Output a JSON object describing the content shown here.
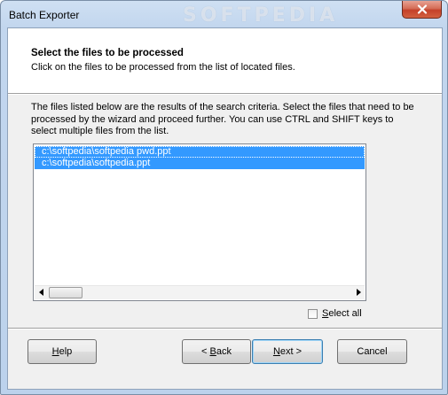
{
  "window": {
    "title": "Batch Exporter",
    "watermark": "SOFTPEDIA"
  },
  "header": {
    "title": "Select the files to be processed",
    "subtitle": "Click on the files to be processed from the list of located files."
  },
  "description": "The files listed below are the results of the search criteria. Select the files that need to be processed by the wizard and proceed further. You can use CTRL and SHIFT keys to select multiple files from the list.",
  "file_list": {
    "items": [
      {
        "path": "c:\\softpedia\\softpedia pwd.ppt",
        "selected": true
      },
      {
        "path": "c:\\softpedia\\softpedia.ppt",
        "selected": true
      }
    ]
  },
  "select_all": {
    "label_mnemonic": "S",
    "label_rest": "elect all",
    "checked": false
  },
  "buttons": {
    "help": {
      "mnemonic": "H",
      "rest": "elp"
    },
    "back": {
      "prefix": "< ",
      "mnemonic": "B",
      "rest": "ack"
    },
    "next": {
      "mnemonic": "N",
      "rest": "ext >"
    },
    "cancel": {
      "label": "Cancel"
    }
  },
  "colors": {
    "selection": "#3399ff",
    "close_button": "#c4412a",
    "title_bar": "#c2d6ee"
  },
  "icons": {
    "close": "close-icon",
    "scroll_left": "arrow-left-icon",
    "scroll_right": "arrow-right-icon"
  }
}
